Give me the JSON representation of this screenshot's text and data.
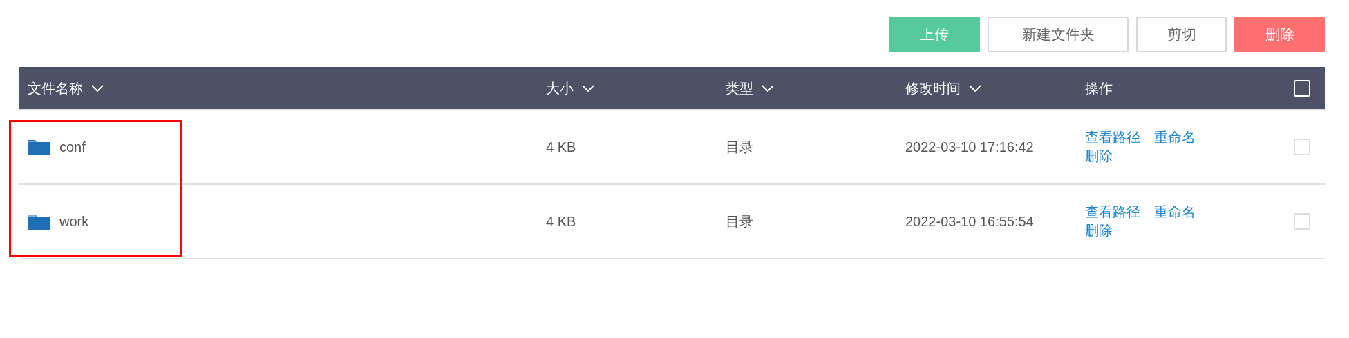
{
  "toolbar": {
    "buttons": [
      {
        "label": "上传",
        "kind": "primary"
      },
      {
        "label": "新建文件夹",
        "kind": "default"
      },
      {
        "label": "剪切",
        "kind": "default"
      },
      {
        "label": "删除",
        "kind": "danger"
      }
    ]
  },
  "table": {
    "columns": [
      {
        "label": "文件名称",
        "sortable": true
      },
      {
        "label": "大小",
        "sortable": true
      },
      {
        "label": "类型",
        "sortable": true
      },
      {
        "label": "修改时间",
        "sortable": true
      },
      {
        "label": "操作",
        "sortable": false
      }
    ],
    "select_all": {
      "checked": false
    },
    "rows": [
      {
        "name": "conf",
        "size": "4 KB",
        "type": "目录",
        "modified": "2022-03-10 17:16:42",
        "actions": [
          "查看路径",
          "重命名",
          "删除"
        ],
        "checked": false
      },
      {
        "name": "work",
        "size": "4 KB",
        "type": "目录",
        "modified": "2022-03-10 16:55:54",
        "actions": [
          "查看路径",
          "重命名",
          "删除"
        ],
        "checked": false
      }
    ]
  }
}
